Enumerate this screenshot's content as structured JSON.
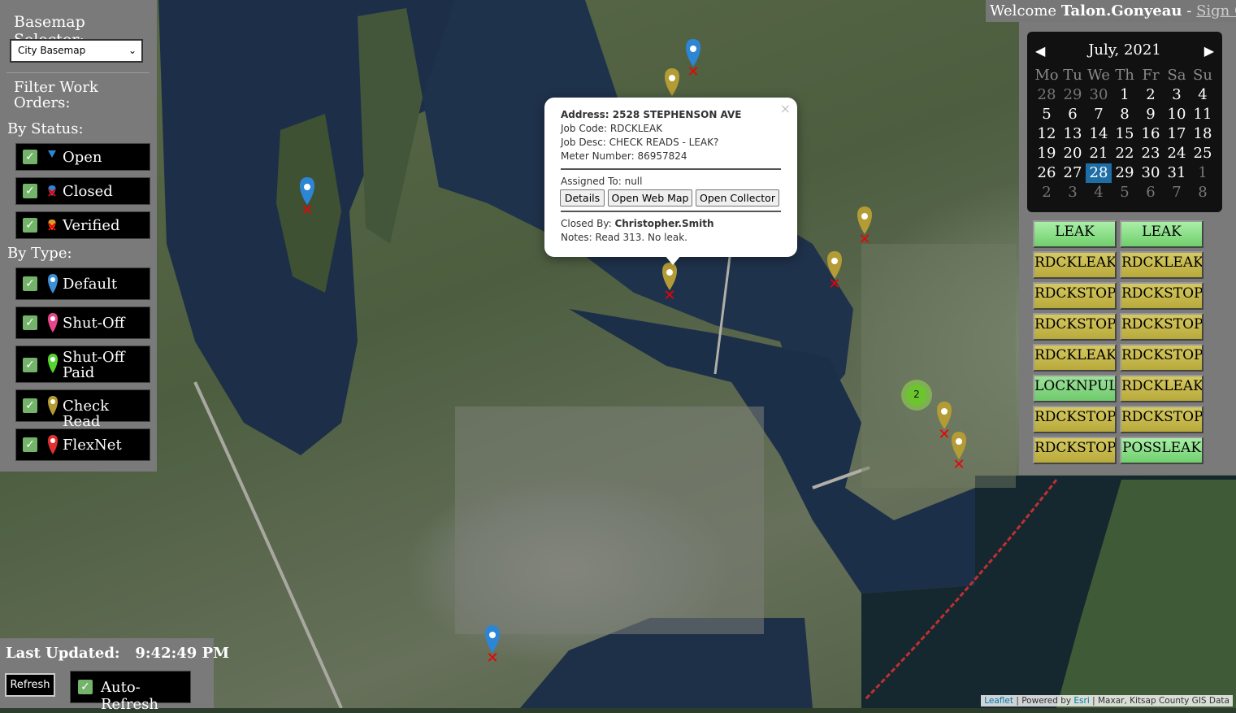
{
  "app": {
    "welcome_prefix": "Welcome",
    "username": "Talon.Gonyeau",
    "separator": "-",
    "signout_label": "Sign Out"
  },
  "left_panel": {
    "basemap_label": "Basemap Selector:",
    "basemap_value": "City Basemap",
    "filter_title": "Filter Work Orders:",
    "status_label": "By Status:",
    "status_filters": [
      {
        "label": "Open",
        "checked": true,
        "icon": "blue-triangle-icon"
      },
      {
        "label": "Closed",
        "checked": true,
        "icon": "closed-marker-icon"
      },
      {
        "label": "Verified",
        "checked": true,
        "icon": "verified-marker-icon"
      }
    ],
    "type_label": "By Type:",
    "type_filters": [
      {
        "label": "Default",
        "checked": true,
        "color": "#3a8fd6"
      },
      {
        "label": "Shut-Off",
        "checked": true,
        "color": "#e8458f"
      },
      {
        "label": "Shut-Off Paid",
        "checked": true,
        "color": "#55d531"
      },
      {
        "label": "Check Read",
        "checked": true,
        "color": "#b39b35"
      },
      {
        "label": "FlexNet",
        "checked": true,
        "color": "#e03030"
      }
    ]
  },
  "calendar": {
    "title": "July, 2021",
    "prev": "◀",
    "next": "▶",
    "weekdays": [
      "Mo",
      "Tu",
      "We",
      "Th",
      "Fr",
      "Sa",
      "Su"
    ],
    "weeks": [
      [
        "28",
        "29",
        "30",
        "1",
        "2",
        "3",
        "4"
      ],
      [
        "5",
        "6",
        "7",
        "8",
        "9",
        "10",
        "11"
      ],
      [
        "12",
        "13",
        "14",
        "15",
        "16",
        "17",
        "18"
      ],
      [
        "19",
        "20",
        "21",
        "22",
        "23",
        "24",
        "25"
      ],
      [
        "26",
        "27",
        "28",
        "29",
        "30",
        "31",
        "1"
      ],
      [
        "2",
        "3",
        "4",
        "5",
        "6",
        "7",
        "8"
      ]
    ],
    "selected": "28"
  },
  "work_orders": [
    [
      "LEAK",
      "LEAK"
    ],
    [
      "RDCKLEAK",
      "RDCKLEAK"
    ],
    [
      "RDCKSTOP",
      "RDCKSTOP"
    ],
    [
      "RDCKSTOP",
      "RDCKSTOP"
    ],
    [
      "RDCKLEAK",
      "RDCKSTOP"
    ],
    [
      "LOCKNPULL",
      "RDCKLEAK"
    ],
    [
      "RDCKSTOP",
      "RDCKSTOP"
    ],
    [
      "RDCKSTOP",
      "POSSLEAK"
    ]
  ],
  "bottom": {
    "last_updated_label": "Last Updated:",
    "last_updated_time": "9:42:49 PM",
    "refresh_label": "Refresh",
    "auto_refresh_label": "Auto-Refresh",
    "auto_refresh_checked": true
  },
  "popup": {
    "close": "×",
    "address_label": "Address:",
    "address": "2528 STEPHENSON AVE",
    "job_code_label": "Job Code:",
    "job_code": "RDCKLEAK",
    "job_desc_label": "Job Desc:",
    "job_desc": "CHECK READS - LEAK?",
    "meter_label": "Meter Number:",
    "meter": "86957824",
    "assigned_label": "Assigned To:",
    "assigned": "null",
    "btn_details": "Details",
    "btn_webmap": "Open Web Map",
    "btn_collector": "Open Collector",
    "closed_by_label": "Closed By:",
    "closed_by": "Christopher.Smith",
    "notes_label": "Notes:",
    "notes": "Read 313. No leak."
  },
  "map": {
    "cluster_count": "2"
  },
  "attribution": {
    "leaflet": "Leaflet",
    "powered": "| Powered by",
    "esri": "Esri",
    "credits": "| Maxar, Kitsap County GIS Data"
  }
}
